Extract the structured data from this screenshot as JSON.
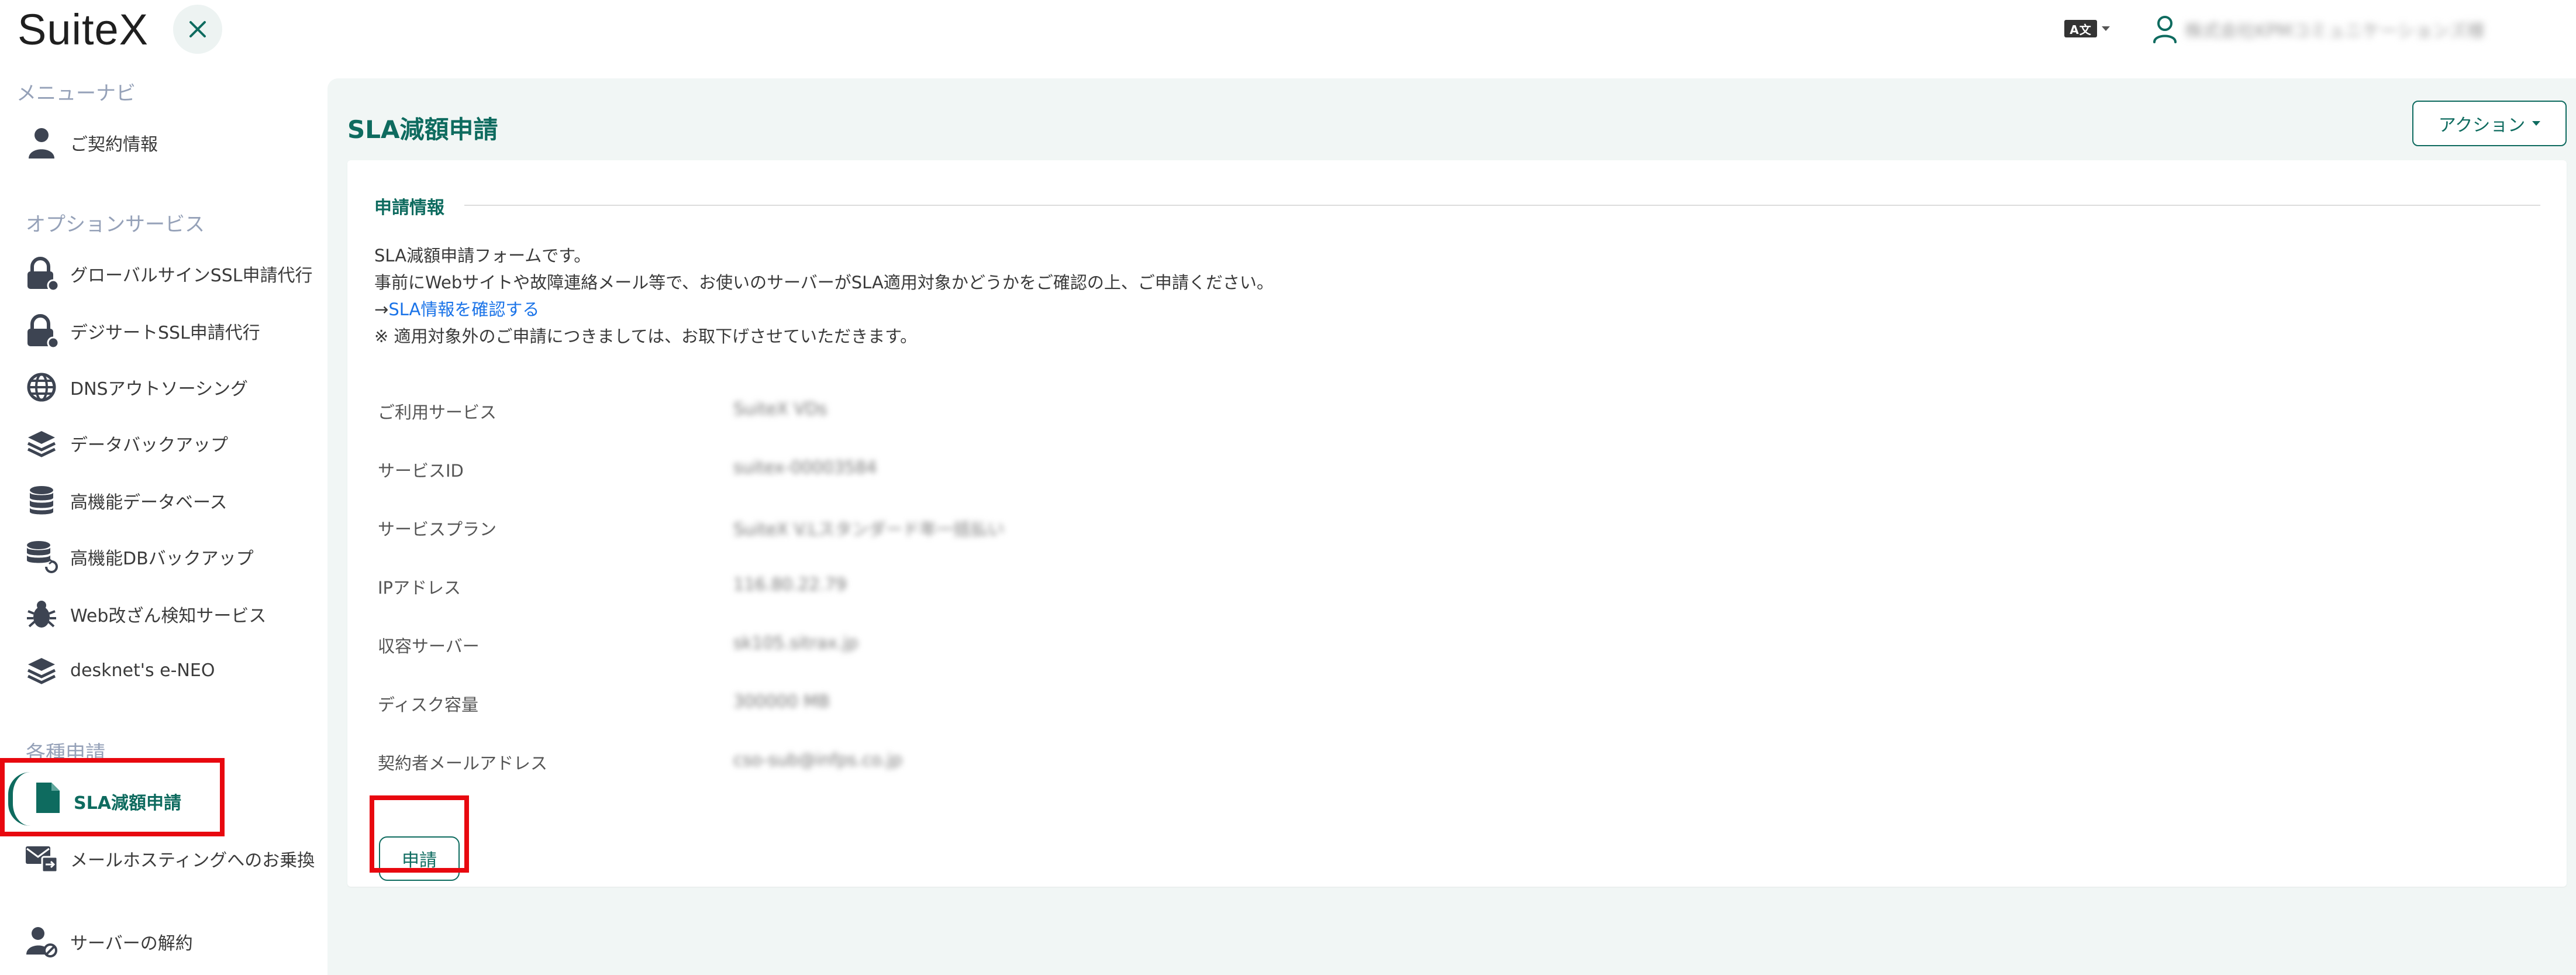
{
  "header": {
    "logo": "SuiteX",
    "language_label": "A文",
    "user_name": "株式会社KPMコミュニケーションズ様"
  },
  "sidebar": {
    "menu_heading": "メニューナビ",
    "contract_info": "ご契約情報",
    "options_heading": "オプションサービス",
    "options": [
      "グローバルサインSSL申請代行",
      "デジサートSSL申請代行",
      "DNSアウトソーシング",
      "データバックアップ",
      "高機能データベース",
      "高機能DBバックアップ",
      "Web改ざん検知サービス",
      "desknet's e-NEO"
    ],
    "applications_heading": "各種申請",
    "active_item": "SLA減額申請",
    "mail_hosting": "メールホスティングへのお乗換",
    "cancel_server": "サーバーの解約"
  },
  "main": {
    "title": "SLA減額申請",
    "action_button": "アクション",
    "section_title": "申請情報",
    "desc_line1": "SLA減額申請フォームです。",
    "desc_line2": "事前にWebサイトや故障連絡メール等で、お使いのサーバーがSLA適用対象かどうかをご確認の上、ご申請ください。",
    "desc_arrow": "→",
    "desc_link": "SLA情報を確認する",
    "desc_line4": "※ 適用対象外のご申請につきましては、お取下げさせていただきます。",
    "rows": [
      {
        "label": "ご利用サービス",
        "value": "SuiteX VDs"
      },
      {
        "label": "サービスID",
        "value": "suitex-00003584"
      },
      {
        "label": "サービスプラン",
        "value": "SuiteX V.Lスタンダード年一括払い"
      },
      {
        "label": "IPアドレス",
        "value": "116.80.22.79"
      },
      {
        "label": "収容サーバー",
        "value": "sk105.sitrax.jp"
      },
      {
        "label": "ディスク容量",
        "value": "300000 MB"
      },
      {
        "label": "契約者メールアドレス",
        "value": "cso-sub@infps.co.jp"
      }
    ],
    "submit_button": "申請"
  },
  "colors": {
    "accent": "#0e6b5f",
    "background": "#f1f6f5",
    "highlight": "#e8080f",
    "link": "#1a73e8"
  }
}
